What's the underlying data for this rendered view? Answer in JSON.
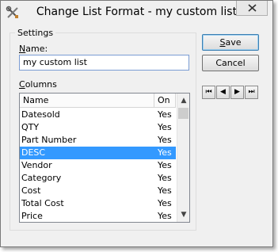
{
  "window": {
    "title": "Change List Format - my custom list",
    "app_icon": "tools-icon",
    "close": "close-icon"
  },
  "settings": {
    "group_label": "Settings",
    "name_label_prefix": "N",
    "name_label_rest": "ame:",
    "name_value": "my custom list",
    "columns_label_prefix": "C",
    "columns_label_rest": "olumns"
  },
  "columns_list": {
    "headers": [
      "Name",
      "On"
    ],
    "rows": [
      {
        "name": "Datesold",
        "on": "Yes"
      },
      {
        "name": "QTY",
        "on": "Yes"
      },
      {
        "name": "Part Number",
        "on": "Yes"
      },
      {
        "name": "DESC",
        "on": "Yes",
        "selected": true
      },
      {
        "name": "Vendor",
        "on": "Yes"
      },
      {
        "name": "Category",
        "on": "Yes"
      },
      {
        "name": "Cost",
        "on": "Yes"
      },
      {
        "name": "Total Cost",
        "on": "Yes"
      },
      {
        "name": "Price",
        "on": "Yes"
      }
    ]
  },
  "buttons": {
    "save_prefix": "S",
    "save_rest": "ave",
    "cancel": "Cancel"
  },
  "nav": {
    "first": "⏮",
    "prev": "◀",
    "next": "▶",
    "last": "⏭"
  },
  "colors": {
    "selection": "#3399ff",
    "window_bg": "#f0f0f0"
  }
}
